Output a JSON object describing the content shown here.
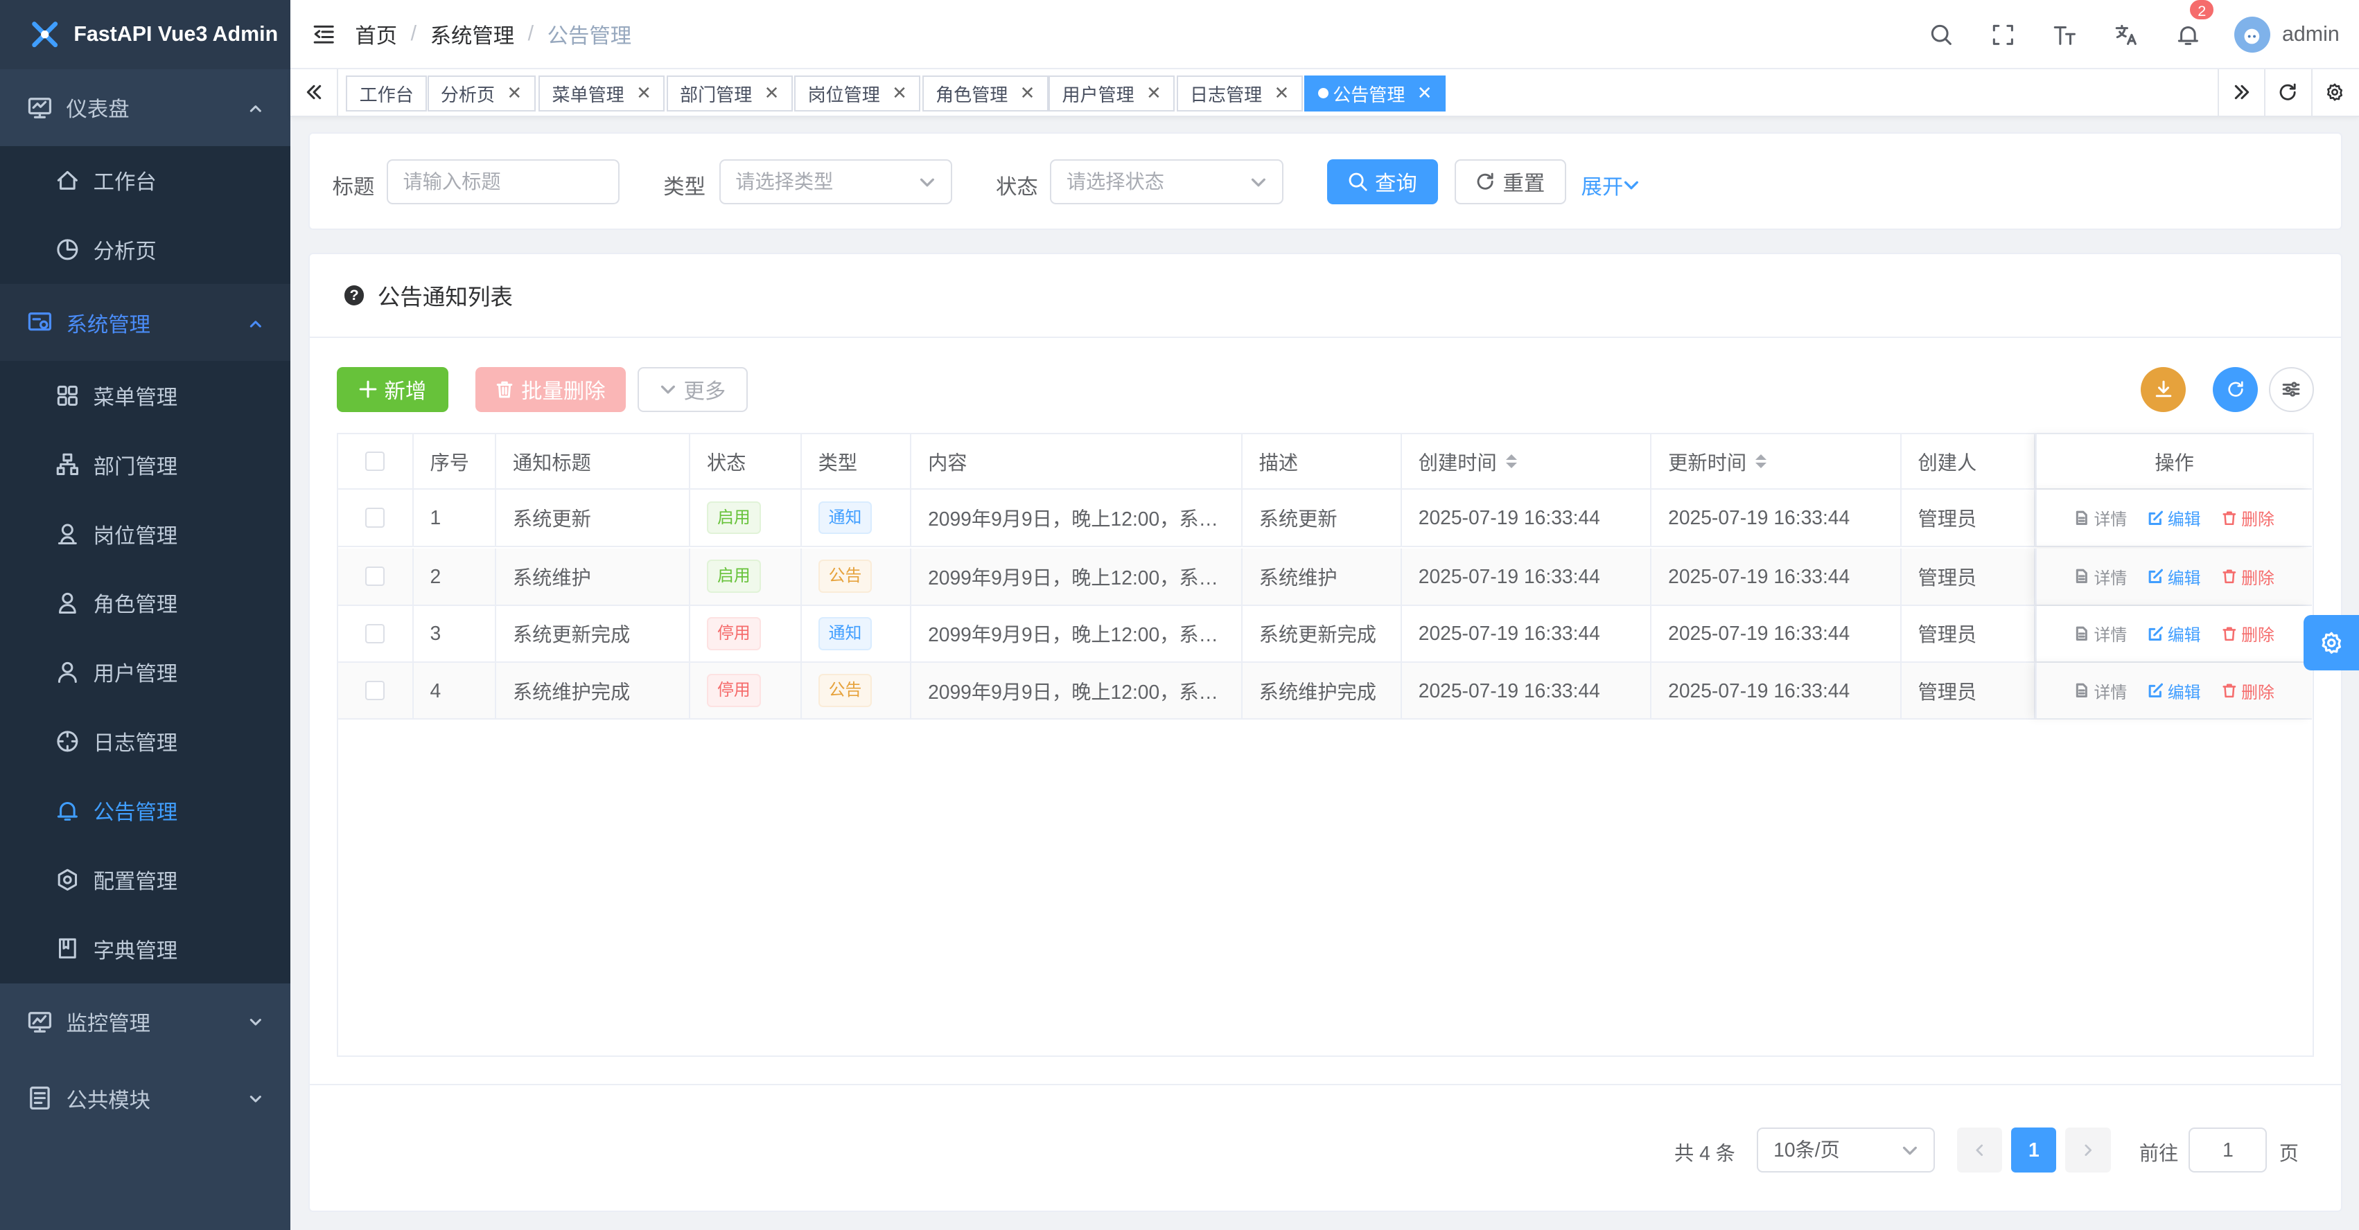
{
  "app": {
    "title": "FastAPI Vue3 Admin"
  },
  "sidebar": {
    "groups": [
      {
        "label": "仪表盘",
        "items": [
          "工作台",
          "分析页"
        ]
      },
      {
        "label": "系统管理",
        "items": [
          "菜单管理",
          "部门管理",
          "岗位管理",
          "角色管理",
          "用户管理",
          "日志管理",
          "公告管理",
          "配置管理",
          "字典管理"
        ]
      },
      {
        "label": "监控管理"
      },
      {
        "label": "公共模块"
      }
    ],
    "active_item": "公告管理"
  },
  "breadcrumb": [
    "首页",
    "系统管理",
    "公告管理"
  ],
  "navbar": {
    "notification_count": "2",
    "username": "admin"
  },
  "tabs": [
    "工作台",
    "分析页",
    "菜单管理",
    "部门管理",
    "岗位管理",
    "角色管理",
    "用户管理",
    "日志管理",
    "公告管理"
  ],
  "search": {
    "title_label": "标题",
    "title_placeholder": "请输入标题",
    "type_label": "类型",
    "type_placeholder": "请选择类型",
    "status_label": "状态",
    "status_placeholder": "请选择状态",
    "query": "查询",
    "reset": "重置",
    "expand": "展开"
  },
  "list": {
    "title": "公告通知列表",
    "add": "新增",
    "batch_delete": "批量删除",
    "more": "更多",
    "columns": [
      "序号",
      "通知标题",
      "状态",
      "类型",
      "内容",
      "描述",
      "创建时间",
      "更新时间",
      "创建人",
      "操作"
    ],
    "rows": [
      {
        "no": "1",
        "title": "系统更新",
        "status": "启用",
        "type": "通知",
        "content": "2099年9月9日，晚上12:00，系…",
        "desc": "系统更新",
        "created": "2025-07-19 16:33:44",
        "updated": "2025-07-19 16:33:44",
        "creator": "管理员"
      },
      {
        "no": "2",
        "title": "系统维护",
        "status": "启用",
        "type": "公告",
        "content": "2099年9月9日，晚上12:00，系…",
        "desc": "系统维护",
        "created": "2025-07-19 16:33:44",
        "updated": "2025-07-19 16:33:44",
        "creator": "管理员"
      },
      {
        "no": "3",
        "title": "系统更新完成",
        "status": "停用",
        "type": "通知",
        "content": "2099年9月9日，晚上12:00，系…",
        "desc": "系统更新完成",
        "created": "2025-07-19 16:33:44",
        "updated": "2025-07-19 16:33:44",
        "creator": "管理员"
      },
      {
        "no": "4",
        "title": "系统维护完成",
        "status": "停用",
        "type": "公告",
        "content": "2099年9月9日，晚上12:00，系…",
        "desc": "系统维护完成",
        "created": "2025-07-19 16:33:44",
        "updated": "2025-07-19 16:33:44",
        "creator": "管理员"
      }
    ],
    "actions": {
      "detail": "详情",
      "edit": "编辑",
      "delete": "删除"
    }
  },
  "pagination": {
    "total": "共 4 条",
    "page_size": "10条/页",
    "current": "1",
    "goto": "前往",
    "goto_value": "1",
    "suffix": "页"
  },
  "colors": {
    "primary": "#409eff",
    "success": "#67c23a",
    "warning": "#e6a23c",
    "danger": "#f56c6c",
    "sidebar": "#304156"
  }
}
